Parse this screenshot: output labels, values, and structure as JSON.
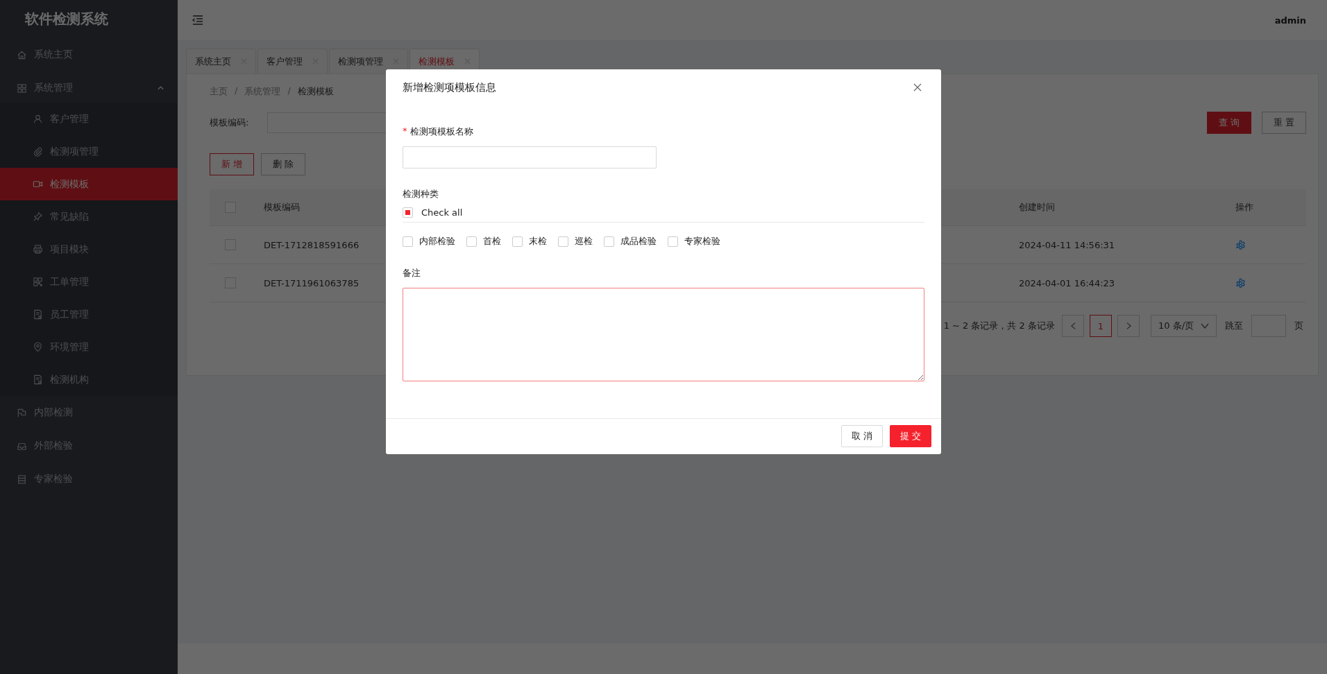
{
  "sidebar": {
    "title": "软件检测系统",
    "items": [
      {
        "label": "系统主页",
        "selected": false
      },
      {
        "label": "系统管理",
        "selected": false,
        "expanded": true,
        "children": [
          {
            "label": "客户管理",
            "selected": false
          },
          {
            "label": "检测项管理",
            "selected": false
          },
          {
            "label": "检测模板",
            "selected": true
          },
          {
            "label": "常见缺陷",
            "selected": false
          },
          {
            "label": "项目模块",
            "selected": false
          },
          {
            "label": "工单管理",
            "selected": false
          },
          {
            "label": "员工管理",
            "selected": false
          },
          {
            "label": "环境管理",
            "selected": false
          },
          {
            "label": "检测机构",
            "selected": false
          }
        ]
      },
      {
        "label": "内部检测",
        "selected": false
      },
      {
        "label": "外部检验",
        "selected": false
      },
      {
        "label": "专家检验",
        "selected": false
      }
    ]
  },
  "header": {
    "user": "admin"
  },
  "tabs": [
    {
      "label": "系统主页",
      "selected": false
    },
    {
      "label": "客户管理",
      "selected": false
    },
    {
      "label": "检测项管理",
      "selected": false
    },
    {
      "label": "检测模板",
      "selected": true
    }
  ],
  "breadcrumb": {
    "separator": "/",
    "items": [
      "主页",
      "系统管理",
      "检测模板"
    ]
  },
  "search": {
    "label": "模板编码:",
    "buttons": [
      {
        "label": "查 询",
        "kind": "primary"
      },
      {
        "label": "重 置",
        "kind": "default"
      }
    ]
  },
  "actions": [
    {
      "label": "新 增",
      "kind": "outline"
    },
    {
      "label": "删 除",
      "kind": "default"
    }
  ],
  "table": {
    "header_checked": false,
    "columns": [
      "模板编码",
      "创建时间",
      "操作"
    ],
    "rows": [
      {
        "checked": false,
        "code": "DET-1712818591666",
        "created": "2024-04-11 14:56:31"
      },
      {
        "checked": false,
        "code": "DET-1711961063785",
        "created": "2024-04-01 16:44:23"
      }
    ]
  },
  "pagination": {
    "summary": "1 ~ 2 条记录，共 2 条记录",
    "pages": [
      {
        "label": "1",
        "selected": true
      }
    ],
    "page_size": "10 条/页",
    "jump_label": "跳至",
    "jump_suffix": "页"
  },
  "modal": {
    "title": "新增检测项模板信息",
    "name_field": {
      "label": "检测项模板名称",
      "required_mark": "*"
    },
    "category": {
      "label": "检测种类",
      "check_all": {
        "label": "Check all",
        "indeterminate": true,
        "checked": false
      },
      "options": [
        {
          "label": "内部检验",
          "checked": false
        },
        {
          "label": "首检",
          "checked": false
        },
        {
          "label": "末检",
          "checked": false
        },
        {
          "label": "巡检",
          "checked": false
        },
        {
          "label": "成品检验",
          "checked": false
        },
        {
          "label": "专家检验",
          "checked": false
        }
      ]
    },
    "remark": {
      "label": "备注"
    },
    "buttons": [
      {
        "label": "取 消",
        "kind": "default"
      },
      {
        "label": "提 交",
        "kind": "primary"
      }
    ]
  }
}
